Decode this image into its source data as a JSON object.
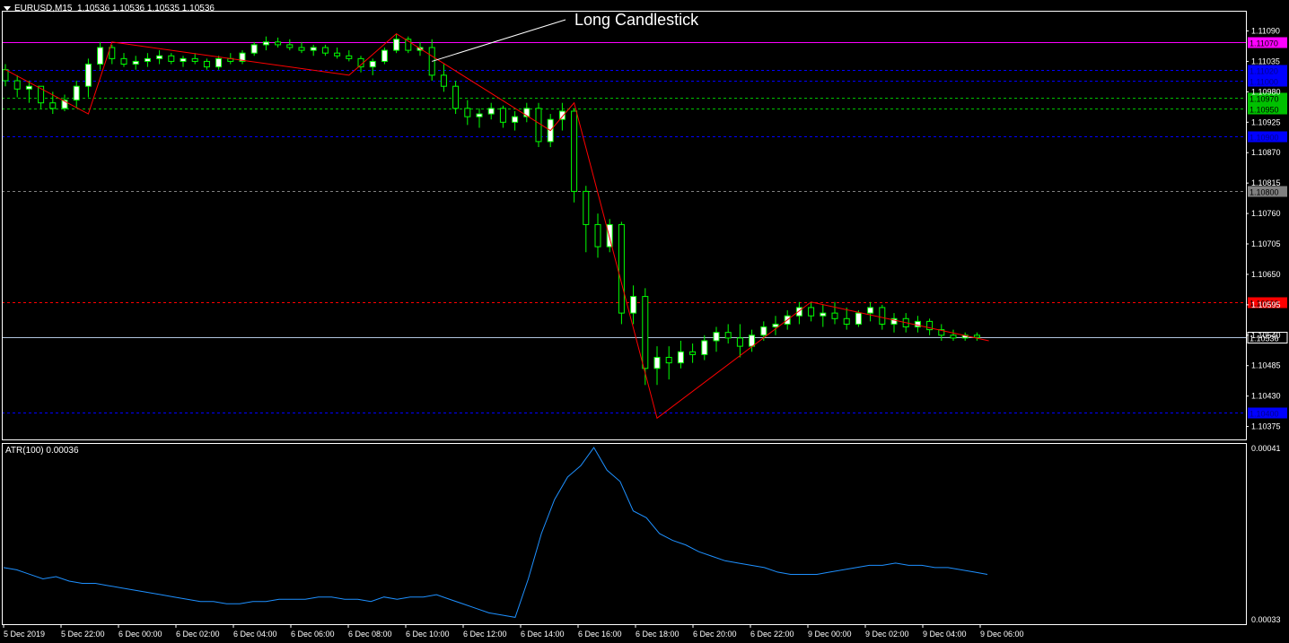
{
  "header": {
    "symbol_label": "EURUSD,M15",
    "ohlc_label": "1.10536 1.10536 1.10535 1.10536"
  },
  "indicator": {
    "label": "ATR(100) 0.00036",
    "axis_top": "0.00041",
    "axis_bottom": "0.00033"
  },
  "annotation": {
    "text": "Long Candlestick"
  },
  "price_axis": {
    "ticks": [
      "1.11090",
      "1.11035",
      "1.10980",
      "1.10925",
      "1.10870",
      "1.10815",
      "1.10760",
      "1.10705",
      "1.10650",
      "1.10595",
      "1.10540",
      "1.10485",
      "1.10430",
      "1.10375"
    ]
  },
  "level_lines": [
    {
      "label": "1.11070",
      "color": "#ff00ff",
      "style": "solid"
    },
    {
      "label": "1.11020",
      "color": "#0000ff",
      "style": "dashed"
    },
    {
      "label": "1.11000",
      "color": "#0000ff",
      "style": "dashed"
    },
    {
      "label": "1.10970",
      "color": "#00c000",
      "style": "dashed"
    },
    {
      "label": "1.10950",
      "color": "#00c000",
      "style": "dashed"
    },
    {
      "label": "1.10900",
      "color": "#0000ff",
      "style": "dashed"
    },
    {
      "label": "1.10800",
      "color": "#808080",
      "style": "dashed"
    },
    {
      "label": "1.10600",
      "color": "#ff0000",
      "style": "dashed"
    },
    {
      "label": "1.10536",
      "color": "#b0c4de",
      "style": "solid"
    },
    {
      "label": "1.10400",
      "color": "#0000ff",
      "style": "dashed"
    }
  ],
  "time_axis": {
    "labels": [
      "5 Dec 2019",
      "5 Dec 22:00",
      "6 Dec 00:00",
      "6 Dec 02:00",
      "6 Dec 04:00",
      "6 Dec 06:00",
      "6 Dec 08:00",
      "6 Dec 10:00",
      "6 Dec 12:00",
      "6 Dec 14:00",
      "6 Dec 16:00",
      "6 Dec 18:00",
      "6 Dec 20:00",
      "6 Dec 22:00",
      "9 Dec 00:00",
      "9 Dec 02:00",
      "9 Dec 04:00",
      "9 Dec 06:00"
    ]
  },
  "colors": {
    "background": "#000000",
    "bull_candle": "#ffffff",
    "bear_candle": "#000000",
    "wick": "#00ff00",
    "zigzag": "#ff0000",
    "atr_line": "#1e90ff",
    "axis": "#ffffff"
  },
  "chart_data": [
    {
      "type": "candlestick",
      "name": "EURUSD,M15",
      "ylim": [
        1.1035,
        1.1112
      ],
      "candles": [
        [
          1.1102,
          1.1103,
          1.1099,
          1.11
        ],
        [
          1.11,
          1.1101,
          1.1097,
          1.10985
        ],
        [
          1.10985,
          1.11,
          1.1096,
          1.1099
        ],
        [
          1.1099,
          1.1099,
          1.1095,
          1.1096
        ],
        [
          1.1096,
          1.1098,
          1.1094,
          1.1095
        ],
        [
          1.1095,
          1.10975,
          1.10945,
          1.10965
        ],
        [
          1.10965,
          1.11,
          1.1095,
          1.1099
        ],
        [
          1.1099,
          1.1104,
          1.1097,
          1.1103
        ],
        [
          1.1103,
          1.1107,
          1.1102,
          1.1106
        ],
        [
          1.1106,
          1.11065,
          1.1103,
          1.1104
        ],
        [
          1.1104,
          1.1105,
          1.11025,
          1.1103
        ],
        [
          1.1103,
          1.11045,
          1.1102,
          1.11035
        ],
        [
          1.11035,
          1.1105,
          1.11025,
          1.1104
        ],
        [
          1.1104,
          1.11055,
          1.1103,
          1.11045
        ],
        [
          1.11045,
          1.1105,
          1.1103,
          1.11035
        ],
        [
          1.11035,
          1.11045,
          1.11025,
          1.1104
        ],
        [
          1.1104,
          1.1105,
          1.1103,
          1.11035
        ],
        [
          1.11035,
          1.1104,
          1.1102,
          1.11025
        ],
        [
          1.11025,
          1.11045,
          1.1102,
          1.1104
        ],
        [
          1.1104,
          1.1105,
          1.1103,
          1.11035
        ],
        [
          1.11035,
          1.11055,
          1.1103,
          1.1105
        ],
        [
          1.1105,
          1.1107,
          1.11045,
          1.11065
        ],
        [
          1.11065,
          1.1108,
          1.11055,
          1.1107
        ],
        [
          1.1107,
          1.11078,
          1.1106,
          1.11065
        ],
        [
          1.11065,
          1.11075,
          1.11055,
          1.1106
        ],
        [
          1.1106,
          1.1107,
          1.1105,
          1.11055
        ],
        [
          1.11055,
          1.11065,
          1.11045,
          1.1106
        ],
        [
          1.1106,
          1.11065,
          1.11045,
          1.1105
        ],
        [
          1.1105,
          1.1106,
          1.1104,
          1.11045
        ],
        [
          1.11045,
          1.11055,
          1.11035,
          1.1104
        ],
        [
          1.1104,
          1.11045,
          1.11015,
          1.11025
        ],
        [
          1.11025,
          1.1104,
          1.1101,
          1.11035
        ],
        [
          1.11035,
          1.1106,
          1.1103,
          1.11055
        ],
        [
          1.11055,
          1.11085,
          1.1105,
          1.11075
        ],
        [
          1.11075,
          1.1108,
          1.1105,
          1.11055
        ],
        [
          1.11055,
          1.1107,
          1.11045,
          1.1106
        ],
        [
          1.1106,
          1.11075,
          1.11,
          1.1101
        ],
        [
          1.1101,
          1.1103,
          1.1098,
          1.1099
        ],
        [
          1.1099,
          1.11,
          1.1094,
          1.1095
        ],
        [
          1.1095,
          1.10965,
          1.1092,
          1.10935
        ],
        [
          1.10935,
          1.1095,
          1.10915,
          1.1094
        ],
        [
          1.1094,
          1.1096,
          1.1093,
          1.1095
        ],
        [
          1.1095,
          1.10955,
          1.10915,
          1.10925
        ],
        [
          1.10925,
          1.10945,
          1.1091,
          1.10935
        ],
        [
          1.10935,
          1.1096,
          1.10925,
          1.1095
        ],
        [
          1.1095,
          1.1096,
          1.1088,
          1.1089
        ],
        [
          1.1089,
          1.1094,
          1.1088,
          1.1093
        ],
        [
          1.1093,
          1.1096,
          1.1091,
          1.10945
        ],
        [
          1.10945,
          1.1095,
          1.1078,
          1.108
        ],
        [
          1.108,
          1.1081,
          1.1069,
          1.1074
        ],
        [
          1.1074,
          1.1076,
          1.1068,
          1.107
        ],
        [
          1.107,
          1.1075,
          1.1069,
          1.1074
        ],
        [
          1.1074,
          1.10745,
          1.1056,
          1.1058
        ],
        [
          1.1058,
          1.1063,
          1.1056,
          1.1061
        ],
        [
          1.1061,
          1.10625,
          1.1045,
          1.1048
        ],
        [
          1.1048,
          1.1052,
          1.1045,
          1.105
        ],
        [
          1.105,
          1.1052,
          1.1046,
          1.1049
        ],
        [
          1.1049,
          1.1053,
          1.1048,
          1.1051
        ],
        [
          1.1051,
          1.10525,
          1.1049,
          1.10505
        ],
        [
          1.10505,
          1.1054,
          1.10495,
          1.1053
        ],
        [
          1.1053,
          1.10555,
          1.1051,
          1.10545
        ],
        [
          1.10545,
          1.1056,
          1.10525,
          1.10535
        ],
        [
          1.10535,
          1.1056,
          1.105,
          1.1052
        ],
        [
          1.1052,
          1.1055,
          1.1051,
          1.1054
        ],
        [
          1.1054,
          1.10565,
          1.1053,
          1.10555
        ],
        [
          1.10555,
          1.10575,
          1.1054,
          1.1056
        ],
        [
          1.1056,
          1.10585,
          1.1055,
          1.10575
        ],
        [
          1.10575,
          1.106,
          1.1056,
          1.1059
        ],
        [
          1.1059,
          1.106,
          1.10565,
          1.10575
        ],
        [
          1.10575,
          1.10595,
          1.10555,
          1.1058
        ],
        [
          1.1058,
          1.106,
          1.1056,
          1.1057
        ],
        [
          1.1057,
          1.1059,
          1.1055,
          1.1056
        ],
        [
          1.1056,
          1.10585,
          1.10555,
          1.1058
        ],
        [
          1.1058,
          1.106,
          1.10565,
          1.1059
        ],
        [
          1.1059,
          1.10595,
          1.1055,
          1.1056
        ],
        [
          1.1056,
          1.1058,
          1.10545,
          1.1057
        ],
        [
          1.1057,
          1.1058,
          1.10545,
          1.10555
        ],
        [
          1.10555,
          1.10575,
          1.10545,
          1.10565
        ],
        [
          1.10565,
          1.1057,
          1.1054,
          1.1055
        ],
        [
          1.1055,
          1.1056,
          1.1053,
          1.1054
        ],
        [
          1.1054,
          1.1055,
          1.1053,
          1.10535
        ],
        [
          1.10535,
          1.10545,
          1.1053,
          1.1054
        ],
        [
          1.1054,
          1.10545,
          1.1053,
          1.10536
        ]
      ],
      "zigzag": [
        [
          0,
          1.1102
        ],
        [
          7,
          1.1094
        ],
        [
          9,
          1.1107
        ],
        [
          29,
          1.1101
        ],
        [
          33,
          1.11085
        ],
        [
          46,
          1.1091
        ],
        [
          48,
          1.1096
        ],
        [
          55,
          1.1039
        ],
        [
          68,
          1.106
        ],
        [
          83,
          1.1053
        ]
      ]
    },
    {
      "type": "line",
      "name": "ATR(100)",
      "ylim": [
        0.00033,
        0.00041
      ],
      "values": [
        0.000355,
        0.000354,
        0.000352,
        0.00035,
        0.000351,
        0.000349,
        0.000348,
        0.000348,
        0.000347,
        0.000346,
        0.000345,
        0.000344,
        0.000343,
        0.000342,
        0.000341,
        0.00034,
        0.00034,
        0.000339,
        0.000339,
        0.00034,
        0.00034,
        0.000341,
        0.000341,
        0.000341,
        0.000342,
        0.000342,
        0.000341,
        0.000341,
        0.00034,
        0.000342,
        0.000341,
        0.000342,
        0.000342,
        0.000343,
        0.000341,
        0.000339,
        0.000337,
        0.000335,
        0.000334,
        0.000333,
        0.00035,
        0.00037,
        0.000385,
        0.000395,
        0.0004,
        0.000408,
        0.000398,
        0.000393,
        0.00038,
        0.000377,
        0.00037,
        0.000367,
        0.000365,
        0.000362,
        0.00036,
        0.000358,
        0.000357,
        0.000356,
        0.000355,
        0.000353,
        0.000352,
        0.000352,
        0.000352,
        0.000353,
        0.000354,
        0.000355,
        0.000356,
        0.000356,
        0.000357,
        0.000356,
        0.000356,
        0.000355,
        0.000355,
        0.000354,
        0.000353,
        0.000352
      ]
    }
  ]
}
